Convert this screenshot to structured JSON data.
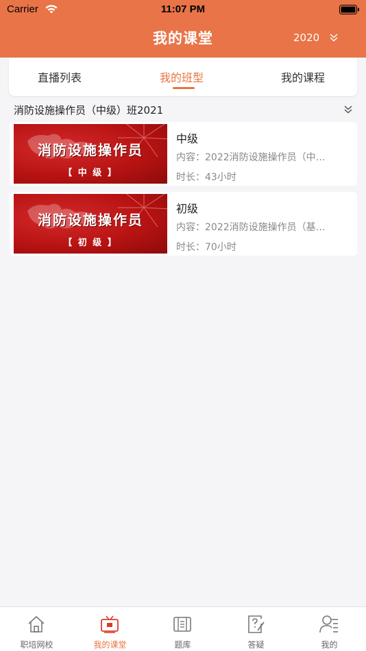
{
  "status_bar": {
    "carrier": "Carrier",
    "time": "11:07 PM"
  },
  "nav": {
    "title": "我的课堂",
    "year": "2020"
  },
  "tabs": [
    {
      "label": "直播列表",
      "active": false
    },
    {
      "label": "我的班型",
      "active": true
    },
    {
      "label": "我的课程",
      "active": false
    }
  ],
  "class_name": "消防设施操作员（中级）班2021",
  "courses": [
    {
      "thumb_title": "消防设施操作员",
      "thumb_level": "【 中 级 】",
      "title": "中级",
      "content": "内容：2022消防设施操作员（中…",
      "duration": "时长：43小时"
    },
    {
      "thumb_title": "消防设施操作员",
      "thumb_level": "【 初 级 】",
      "title": "初级",
      "content": "内容：2022消防设施操作员（基…",
      "duration": "时长：70小时"
    }
  ],
  "tabbar": [
    {
      "label": "职培网校",
      "icon": "home-icon",
      "active": false
    },
    {
      "label": "我的课堂",
      "icon": "tv-icon",
      "active": true
    },
    {
      "label": "题库",
      "icon": "question-bank-icon",
      "active": false
    },
    {
      "label": "答疑",
      "icon": "qa-icon",
      "active": false
    },
    {
      "label": "我的",
      "icon": "profile-icon",
      "active": false
    }
  ],
  "colors": {
    "brand": "#e87447",
    "accent": "#e8743f",
    "background": "#f5f5f7"
  }
}
